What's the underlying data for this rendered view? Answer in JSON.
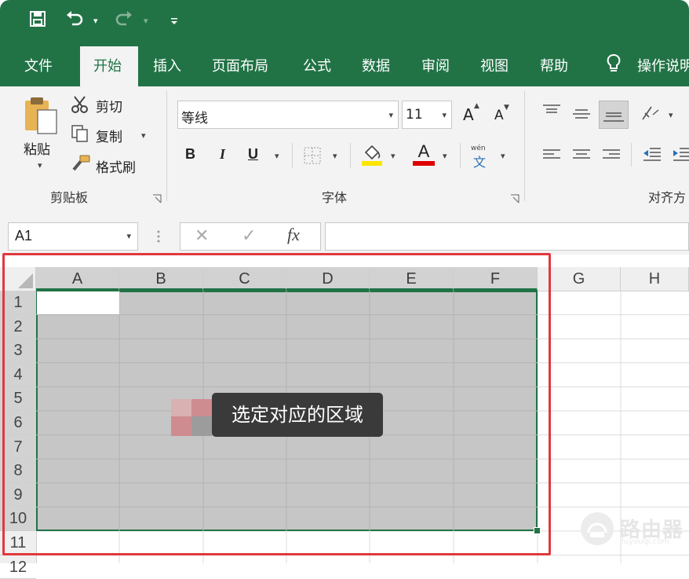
{
  "quick_access": {
    "save": "\u0001",
    "undo": "↶",
    "redo": "↷",
    "more": "▾"
  },
  "tabs": [
    "文件",
    "开始",
    "插入",
    "页面布局",
    "公式",
    "数据",
    "审阅",
    "视图",
    "帮助"
  ],
  "tell_me": "操作说明",
  "clipboard": {
    "paste": "粘贴",
    "cut": "剪切",
    "copy": "复制",
    "format_painter": "格式刷",
    "group": "剪贴板"
  },
  "font": {
    "name": "等线",
    "size": "11",
    "bold": "B",
    "italic": "I",
    "underline": "U",
    "grow": "A",
    "shrink": "A",
    "font_color_letter": "A",
    "wen": "wén",
    "wen_char": "文",
    "group": "字体"
  },
  "alignment": {
    "group": "对齐方"
  },
  "formula_bar": {
    "name_box": "A1",
    "cancel": "✕",
    "enter": "✓",
    "fx": "fx"
  },
  "columns": [
    "A",
    "B",
    "C",
    "D",
    "E",
    "F",
    "G",
    "H"
  ],
  "rows": [
    "1",
    "2",
    "3",
    "4",
    "5",
    "6",
    "7",
    "8",
    "9",
    "10",
    "11",
    "12"
  ],
  "tooltip": "选定对应的区域",
  "watermark": {
    "text": "路由器",
    "sub": "luyouqi.com"
  },
  "colors": {
    "excel_green": "#217346",
    "highlight_red": "#e0393e",
    "font_red": "#e00000",
    "fill_yellow": "#ffe600"
  }
}
